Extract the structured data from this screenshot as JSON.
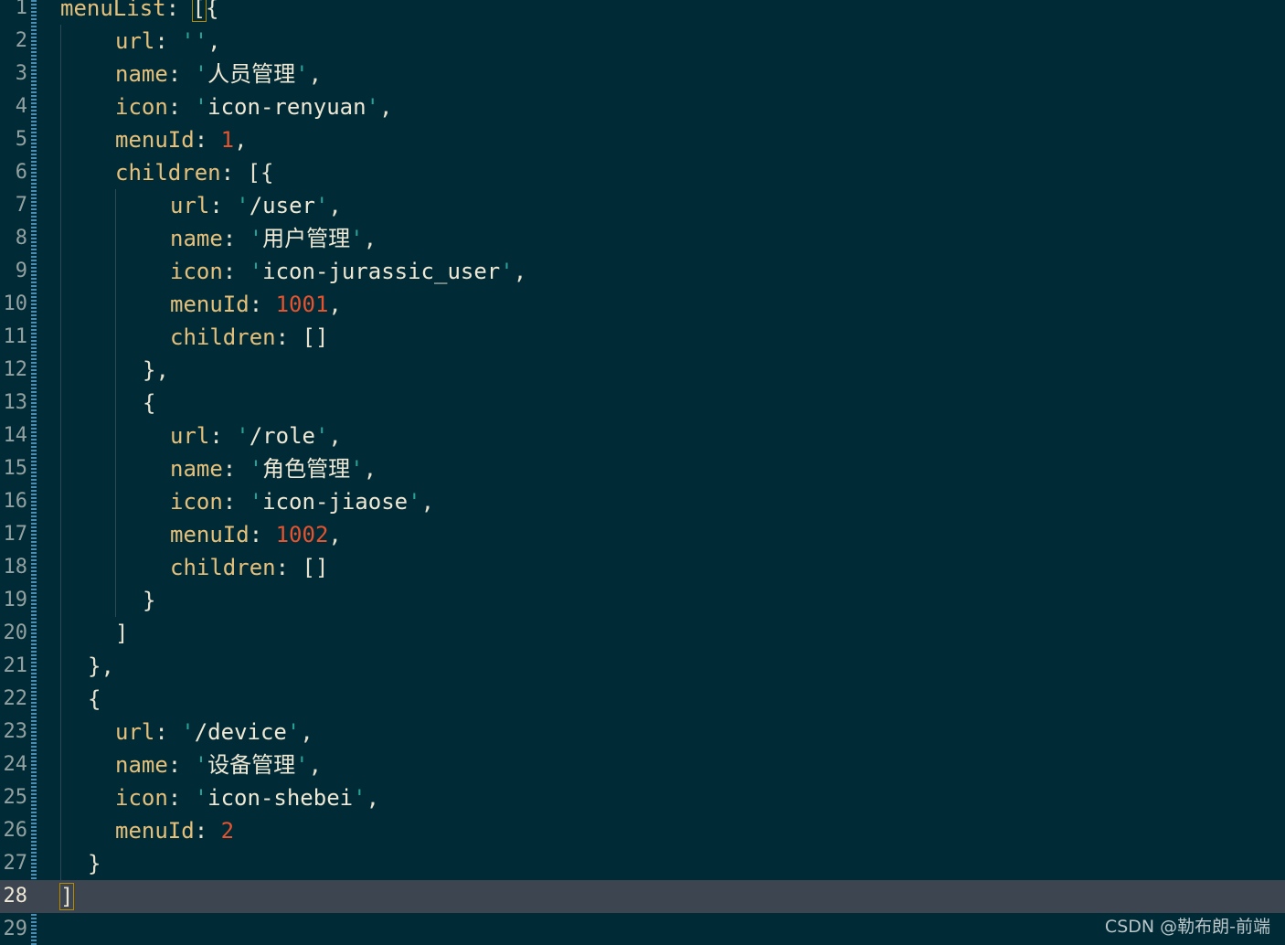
{
  "editor": {
    "theme_colors": {
      "background": "#002b36",
      "key": "#e5c07b",
      "number": "#e5532f",
      "quote": "#2aa198",
      "current_line": "#3d4650"
    },
    "current_line": 28,
    "lines": [
      {
        "n": "1",
        "indent": 0,
        "tokens": [
          [
            "key",
            "menuList"
          ],
          [
            "punct",
            ": "
          ],
          [
            "bracket",
            "["
          ],
          [
            "punct",
            "{"
          ]
        ]
      },
      {
        "n": "2",
        "indent": 1,
        "tokens": [
          [
            "key",
            "url"
          ],
          [
            "punct",
            ": "
          ],
          [
            "quote",
            "''"
          ],
          [
            "punct",
            ","
          ]
        ]
      },
      {
        "n": "3",
        "indent": 1,
        "tokens": [
          [
            "key",
            "name"
          ],
          [
            "punct",
            ": "
          ],
          [
            "quote",
            "'"
          ],
          [
            "str",
            "人员管理"
          ],
          [
            "quote",
            "'"
          ],
          [
            "punct",
            ","
          ]
        ]
      },
      {
        "n": "4",
        "indent": 1,
        "tokens": [
          [
            "key",
            "icon"
          ],
          [
            "punct",
            ": "
          ],
          [
            "quote",
            "'"
          ],
          [
            "str",
            "icon-renyuan"
          ],
          [
            "quote",
            "'"
          ],
          [
            "punct",
            ","
          ]
        ]
      },
      {
        "n": "5",
        "indent": 1,
        "tokens": [
          [
            "key",
            "menuId"
          ],
          [
            "punct",
            ": "
          ],
          [
            "num",
            "1"
          ],
          [
            "punct",
            ","
          ]
        ]
      },
      {
        "n": "6",
        "indent": 1,
        "tokens": [
          [
            "key",
            "children"
          ],
          [
            "punct",
            ": [{"
          ]
        ]
      },
      {
        "n": "7",
        "indent": 2,
        "tokens": [
          [
            "key",
            "url"
          ],
          [
            "punct",
            ": "
          ],
          [
            "quote",
            "'"
          ],
          [
            "str",
            "/user"
          ],
          [
            "quote",
            "'"
          ],
          [
            "punct",
            ","
          ]
        ]
      },
      {
        "n": "8",
        "indent": 2,
        "tokens": [
          [
            "key",
            "name"
          ],
          [
            "punct",
            ": "
          ],
          [
            "quote",
            "'"
          ],
          [
            "str",
            "用户管理"
          ],
          [
            "quote",
            "'"
          ],
          [
            "punct",
            ","
          ]
        ]
      },
      {
        "n": "9",
        "indent": 2,
        "tokens": [
          [
            "key",
            "icon"
          ],
          [
            "punct",
            ": "
          ],
          [
            "quote",
            "'"
          ],
          [
            "str",
            "icon-jurassic_user"
          ],
          [
            "quote",
            "'"
          ],
          [
            "punct",
            ","
          ]
        ]
      },
      {
        "n": "10",
        "indent": 2,
        "tokens": [
          [
            "key",
            "menuId"
          ],
          [
            "punct",
            ": "
          ],
          [
            "num",
            "1001"
          ],
          [
            "punct",
            ","
          ]
        ]
      },
      {
        "n": "11",
        "indent": 2,
        "tokens": [
          [
            "key",
            "children"
          ],
          [
            "punct",
            ": []"
          ]
        ]
      },
      {
        "n": "12",
        "indent": 1.5,
        "tokens": [
          [
            "punct",
            "},"
          ]
        ]
      },
      {
        "n": "13",
        "indent": 1.5,
        "tokens": [
          [
            "punct",
            "{"
          ]
        ]
      },
      {
        "n": "14",
        "indent": 2,
        "tokens": [
          [
            "key",
            "url"
          ],
          [
            "punct",
            ": "
          ],
          [
            "quote",
            "'"
          ],
          [
            "str",
            "/role"
          ],
          [
            "quote",
            "'"
          ],
          [
            "punct",
            ","
          ]
        ]
      },
      {
        "n": "15",
        "indent": 2,
        "tokens": [
          [
            "key",
            "name"
          ],
          [
            "punct",
            ": "
          ],
          [
            "quote",
            "'"
          ],
          [
            "str",
            "角色管理"
          ],
          [
            "quote",
            "'"
          ],
          [
            "punct",
            ","
          ]
        ]
      },
      {
        "n": "16",
        "indent": 2,
        "tokens": [
          [
            "key",
            "icon"
          ],
          [
            "punct",
            ": "
          ],
          [
            "quote",
            "'"
          ],
          [
            "str",
            "icon-jiaose"
          ],
          [
            "quote",
            "'"
          ],
          [
            "punct",
            ","
          ]
        ]
      },
      {
        "n": "17",
        "indent": 2,
        "tokens": [
          [
            "key",
            "menuId"
          ],
          [
            "punct",
            ": "
          ],
          [
            "num",
            "1002"
          ],
          [
            "punct",
            ","
          ]
        ]
      },
      {
        "n": "18",
        "indent": 2,
        "tokens": [
          [
            "key",
            "children"
          ],
          [
            "punct",
            ": []"
          ]
        ]
      },
      {
        "n": "19",
        "indent": 1.5,
        "tokens": [
          [
            "punct",
            "}"
          ]
        ]
      },
      {
        "n": "20",
        "indent": 1,
        "tokens": [
          [
            "punct",
            "]"
          ]
        ]
      },
      {
        "n": "21",
        "indent": 0.5,
        "tokens": [
          [
            "punct",
            "},"
          ]
        ]
      },
      {
        "n": "22",
        "indent": 0.5,
        "tokens": [
          [
            "punct",
            "{"
          ]
        ]
      },
      {
        "n": "23",
        "indent": 1,
        "tokens": [
          [
            "key",
            "url"
          ],
          [
            "punct",
            ": "
          ],
          [
            "quote",
            "'"
          ],
          [
            "str",
            "/device"
          ],
          [
            "quote",
            "'"
          ],
          [
            "punct",
            ","
          ]
        ]
      },
      {
        "n": "24",
        "indent": 1,
        "tokens": [
          [
            "key",
            "name"
          ],
          [
            "punct",
            ": "
          ],
          [
            "quote",
            "'"
          ],
          [
            "str",
            "设备管理"
          ],
          [
            "quote",
            "'"
          ],
          [
            "punct",
            ","
          ]
        ]
      },
      {
        "n": "25",
        "indent": 1,
        "tokens": [
          [
            "key",
            "icon"
          ],
          [
            "punct",
            ": "
          ],
          [
            "quote",
            "'"
          ],
          [
            "str",
            "icon-shebei"
          ],
          [
            "quote",
            "'"
          ],
          [
            "punct",
            ","
          ]
        ]
      },
      {
        "n": "26",
        "indent": 1,
        "tokens": [
          [
            "key",
            "menuId"
          ],
          [
            "punct",
            ": "
          ],
          [
            "num",
            "2"
          ]
        ]
      },
      {
        "n": "27",
        "indent": 0.5,
        "tokens": [
          [
            "punct",
            "}"
          ]
        ]
      },
      {
        "n": "28",
        "indent": 0,
        "tokens": [
          [
            "bracket",
            "]"
          ]
        ]
      },
      {
        "n": "29",
        "indent": 0,
        "tokens": []
      }
    ]
  },
  "watermark": "CSDN @勒布朗-前端"
}
